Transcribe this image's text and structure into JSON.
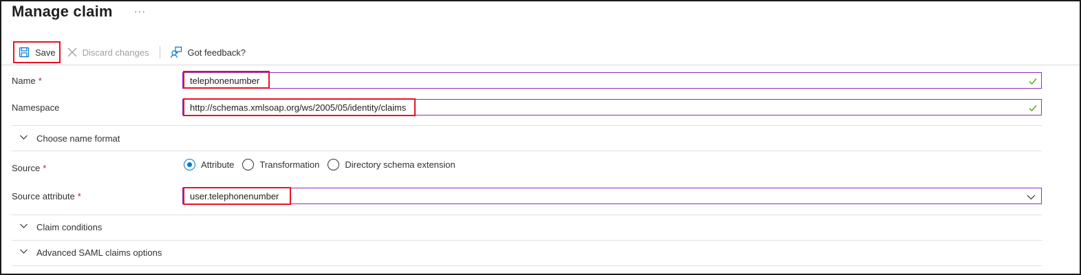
{
  "page": {
    "title": "Manage claim",
    "more_label": "···"
  },
  "toolbar": {
    "save_label": "Save",
    "discard_label": "Discard changes",
    "feedback_label": "Got feedback?"
  },
  "form": {
    "name": {
      "label": "Name",
      "required_mark": "*",
      "value": "telephonenumber"
    },
    "namespace": {
      "label": "Namespace",
      "value": "http://schemas.xmlsoap.org/ws/2005/05/identity/claims"
    },
    "name_format_section": "Choose name format",
    "source": {
      "label": "Source",
      "required_mark": "*",
      "options": [
        "Attribute",
        "Transformation",
        "Directory schema extension"
      ],
      "selected": "Attribute"
    },
    "source_attribute": {
      "label": "Source attribute",
      "required_mark": "*",
      "value": "user.telephonenumber"
    },
    "claim_conditions_section": "Claim conditions",
    "advanced_section": "Advanced SAML claims options"
  },
  "colors": {
    "accent": "#0078d4",
    "highlight": "#e81123",
    "field_border": "#8a2bc4",
    "valid_check": "#57a300",
    "required": "#a4262c"
  },
  "icons": {
    "save": "save-icon",
    "discard": "close-icon",
    "feedback": "feedback-icon",
    "valid": "checkmark-icon",
    "expand": "chevron-down-icon"
  }
}
